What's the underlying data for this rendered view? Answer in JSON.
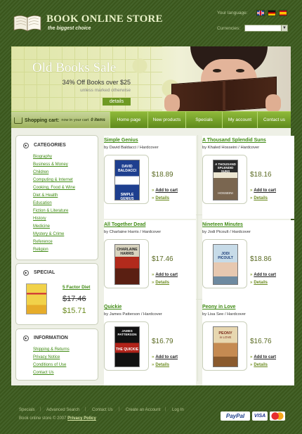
{
  "header": {
    "store_title": "BOOK ONLINE STORE",
    "tagline": "the biggest choice",
    "language_label": "Your language:",
    "currencies_label": "Currencies:",
    "languages": [
      "english-flag",
      "german-flag",
      "spanish-flag"
    ]
  },
  "banner": {
    "title": "Old Books Sale",
    "offer": "34% Off Books over $25",
    "note": "unless marked otherwise",
    "details": "details"
  },
  "cart": {
    "label": "Shopping cart:",
    "now": "now in your cart",
    "count": "0 items"
  },
  "nav": [
    "Home page",
    "New products",
    "Specials",
    "My account",
    "Contact us"
  ],
  "categories": {
    "title": "CATEGORIES",
    "items": [
      "Biography",
      "Business & Money",
      "Children",
      "Computing & Internet",
      "Cooking, Food & Wine",
      "Diet & Health",
      "Education",
      "Fiction & Literature",
      "History",
      "Medicine",
      "Mystery & Crime",
      "Reference",
      "Religion"
    ]
  },
  "special": {
    "title": "SPECIAL",
    "name": "5 Factor Diet",
    "old_price": "$17.46",
    "new_price": "$15.71"
  },
  "information": {
    "title": "INFORMATION",
    "items": [
      "Shipping & Returns",
      "Privacy Notice",
      "Conditions of Use",
      "Contact Us"
    ]
  },
  "products": [
    {
      "title": "Simple Genius",
      "author": "by David Baldacci / Hardcover",
      "price": "$18.89",
      "cover_text": "DAVID BALDACCI",
      "cover_sub": "SIMPLE GENIUS"
    },
    {
      "title": "A Thousand Splendid Suns",
      "author": "by Khaled Hosseini / Hardcover",
      "price": "$18.16",
      "cover_text": "A THOUSAND SPLENDID SUNS",
      "cover_sub": "HOSSEINI"
    },
    {
      "title": "All Together Dead",
      "author": "by Charlaine Harris / Hardcover",
      "price": "$17.46",
      "cover_text": "CHARLAINE HARRIS",
      "cover_sub": ""
    },
    {
      "title": "Nineteen Minutes",
      "author": "by Jodi Picoult / Hardcover",
      "price": "$18.86",
      "cover_text": "JODI PICOULT",
      "cover_sub": ""
    },
    {
      "title": "Quickie",
      "author": "by James Patterson / Hardcover",
      "price": "$16.79",
      "cover_text": "JAMES PATTERSON",
      "cover_sub": "THE QUICKIE"
    },
    {
      "title": "Peony in Love",
      "author": "by Lisa See / Hardcover",
      "price": "$16.76",
      "cover_text": "PEONY",
      "cover_sub": "in LOVE"
    }
  ],
  "product_labels": {
    "add_to_cart": "Add to cart",
    "details": "Details"
  },
  "footer": {
    "links": [
      "Specials",
      "Advanced Search",
      "Contact Us",
      "Create an Account",
      "Log In"
    ],
    "copyright": "Book online store © 2007",
    "privacy": "Privacy Policy",
    "paypal": "PayPal",
    "visa": "VISA"
  },
  "colors": {
    "accent_green": "#6a8a1e",
    "link_green": "#3f8a12",
    "background": "#3e5a1e"
  }
}
